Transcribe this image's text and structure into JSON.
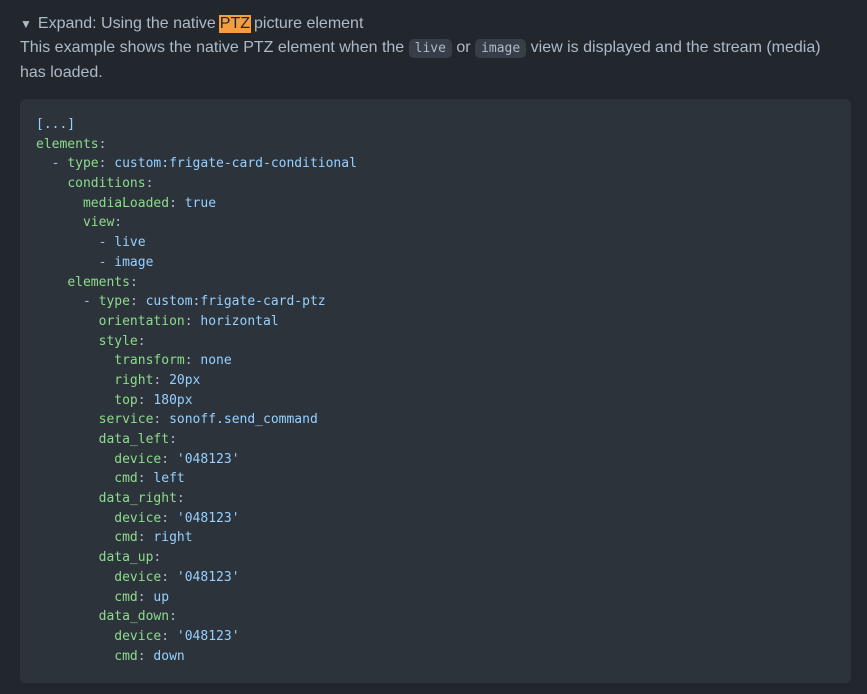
{
  "summary": {
    "prefix": "Expand: Using the native ",
    "highlight": "PTZ",
    "suffix": " picture element"
  },
  "description": {
    "part1": "This example shows the native PTZ element when the ",
    "code1": "live",
    "part2": " or ",
    "code2": "image",
    "part3": " view is displayed and the stream (media) has loaded."
  },
  "code_lines": [
    {
      "indent": 0,
      "key": "",
      "sep": "",
      "value": "[...]"
    },
    {
      "indent": 0,
      "key": "elements",
      "sep": ":",
      "value": ""
    },
    {
      "indent": 2,
      "dash": true,
      "key": "type",
      "sep": ": ",
      "value": "custom:frigate-card-conditional"
    },
    {
      "indent": 4,
      "key": "conditions",
      "sep": ":",
      "value": ""
    },
    {
      "indent": 6,
      "key": "mediaLoaded",
      "sep": ": ",
      "value": "true"
    },
    {
      "indent": 6,
      "key": "view",
      "sep": ":",
      "value": ""
    },
    {
      "indent": 8,
      "dash": true,
      "key": "",
      "sep": "",
      "value": "live"
    },
    {
      "indent": 8,
      "dash": true,
      "key": "",
      "sep": "",
      "value": "image"
    },
    {
      "indent": 4,
      "key": "elements",
      "sep": ":",
      "value": ""
    },
    {
      "indent": 6,
      "dash": true,
      "key": "type",
      "sep": ": ",
      "value": "custom:frigate-card-ptz"
    },
    {
      "indent": 8,
      "key": "orientation",
      "sep": ": ",
      "value": "horizontal"
    },
    {
      "indent": 8,
      "key": "style",
      "sep": ":",
      "value": ""
    },
    {
      "indent": 10,
      "key": "transform",
      "sep": ": ",
      "value": "none"
    },
    {
      "indent": 10,
      "key": "right",
      "sep": ": ",
      "value": "20px"
    },
    {
      "indent": 10,
      "key": "top",
      "sep": ": ",
      "value": "180px"
    },
    {
      "indent": 8,
      "key": "service",
      "sep": ": ",
      "value": "sonoff.send_command"
    },
    {
      "indent": 8,
      "key": "data_left",
      "sep": ":",
      "value": ""
    },
    {
      "indent": 10,
      "key": "device",
      "sep": ": ",
      "value": "'048123'"
    },
    {
      "indent": 10,
      "key": "cmd",
      "sep": ": ",
      "value": "left"
    },
    {
      "indent": 8,
      "key": "data_right",
      "sep": ":",
      "value": ""
    },
    {
      "indent": 10,
      "key": "device",
      "sep": ": ",
      "value": "'048123'"
    },
    {
      "indent": 10,
      "key": "cmd",
      "sep": ": ",
      "value": "right"
    },
    {
      "indent": 8,
      "key": "data_up",
      "sep": ":",
      "value": ""
    },
    {
      "indent": 10,
      "key": "device",
      "sep": ": ",
      "value": "'048123'"
    },
    {
      "indent": 10,
      "key": "cmd",
      "sep": ": ",
      "value": "up"
    },
    {
      "indent": 8,
      "key": "data_down",
      "sep": ":",
      "value": ""
    },
    {
      "indent": 10,
      "key": "device",
      "sep": ": ",
      "value": "'048123'"
    },
    {
      "indent": 10,
      "key": "cmd",
      "sep": ": ",
      "value": "down"
    }
  ],
  "colors": {
    "background": "#22272e",
    "code_background": "#2d333b",
    "key": "#8ddb8c",
    "value": "#96d0ff",
    "highlight": "#f69d3e"
  },
  "icons": {
    "summary_marker": "triangle-down-icon"
  }
}
